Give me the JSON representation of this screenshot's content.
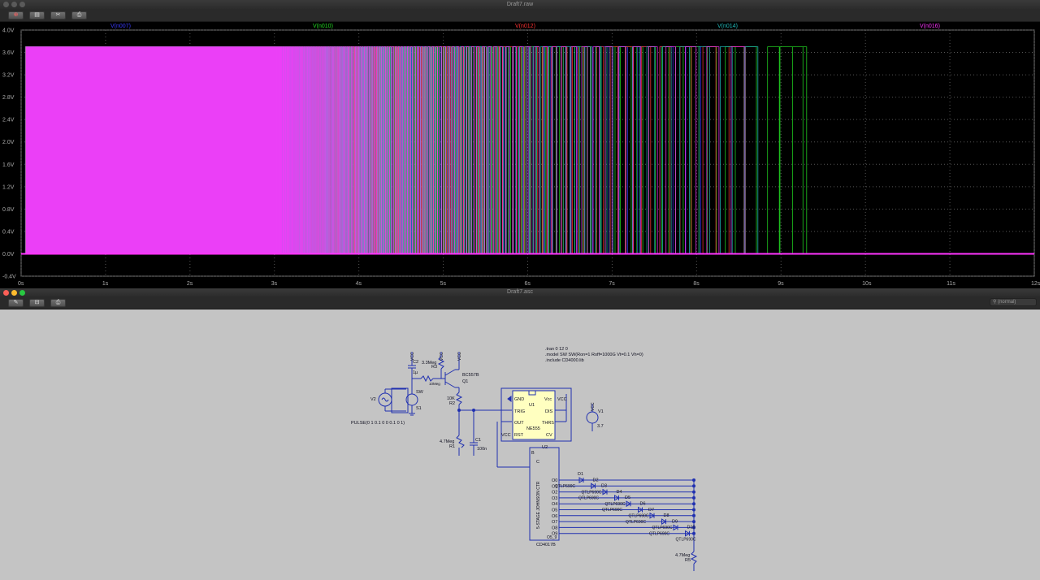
{
  "waveform_window": {
    "title": "Draft7.raw",
    "toolbar": [
      "zoom-tool",
      "chart-tool",
      "cut-tool",
      "print-tool"
    ]
  },
  "schematic_window": {
    "title": "Draft7.asc",
    "search_placeholder": "(normal)",
    "toolbar": [
      "wrench-tool",
      "lock-tool",
      "print-tool"
    ]
  },
  "chart_data": {
    "type": "line",
    "series": [
      {
        "name": "V(n007)",
        "color": "#3a3aff",
        "last_edge_s": 7.9
      },
      {
        "name": "V(n010)",
        "color": "#22dd22",
        "last_edge_s": 9.3
      },
      {
        "name": "V(n012)",
        "color": "#ff3333",
        "last_edge_s": 8.4
      },
      {
        "name": "V(n014)",
        "color": "#22bbbb",
        "last_edge_s": 8.8
      },
      {
        "name": "V(n016)",
        "color": "#ff33ff",
        "last_edge_s": 8.6
      }
    ],
    "high_level_V": 3.7,
    "low_level_V": 0.0,
    "xlim": [
      0,
      12
    ],
    "ylim": [
      -0.4,
      4.0
    ],
    "x_ticks": [
      "0s",
      "1s",
      "2s",
      "3s",
      "4s",
      "5s",
      "6s",
      "7s",
      "8s",
      "9s",
      "10s",
      "11s",
      "12s"
    ],
    "y_ticks": [
      "4.0V",
      "3.6V",
      "3.2V",
      "2.8V",
      "2.4V",
      "2.0V",
      "1.6V",
      "1.2V",
      "0.8V",
      "0.4V",
      "0.0V",
      "-0.4V"
    ],
    "grid": true
  },
  "schematic": {
    "directives": [
      ".tran 0 12 0",
      ".model SW SW(Ron=1 Roff=1000G Vt=0.1 Vh=0)",
      ".include CD4000.lib"
    ],
    "pulse_source": "PULSE(0 1 0.1 0 0 0.1 0 1)",
    "vcc_label": "VCC",
    "labels": {
      "V2": "V2",
      "S1": "S1",
      "SW": "SW",
      "C2": "C2",
      "C2_val": "1µ",
      "R3": "R3",
      "R3_val": "3.3Meg",
      "R4": "R4",
      "R4_val": "10Meg",
      "Q1": "Q1",
      "Q1_type": "BC557B",
      "R2": "R2",
      "R2_val": "10K",
      "R1": "R1",
      "R1_val": "4.7Meg",
      "C1": "C1",
      "C1_val": "100n",
      "U1": "U1",
      "U1_type": "NE555",
      "V1": "V1",
      "V1_val": "3.7",
      "U2": "U2",
      "U2_type": "CD4017B",
      "U2_desc": "5-STAGE JOHNSON CTR",
      "R5": "R5",
      "R5_val": "4.7Meg"
    },
    "ne555_pins": {
      "gnd": "GND",
      "vcc": "Vcc",
      "trig": "TRIG",
      "dis": "DIS",
      "out": "OUT",
      "thrs": "THRS",
      "rst": "RST",
      "cv": "CV"
    },
    "cd4017_outputs": [
      "O0",
      "O1",
      "O2",
      "O3",
      "O4",
      "O5",
      "O6",
      "O7",
      "O8",
      "O9"
    ],
    "cd4017_pins": {
      "b": "B",
      "c": "C",
      "o5_9": "O5_9"
    },
    "leds": [
      "D1",
      "D2",
      "D3",
      "D4",
      "D5",
      "D6",
      "D7",
      "D8",
      "D9",
      "D10"
    ],
    "led_model": "QTLP690C"
  }
}
